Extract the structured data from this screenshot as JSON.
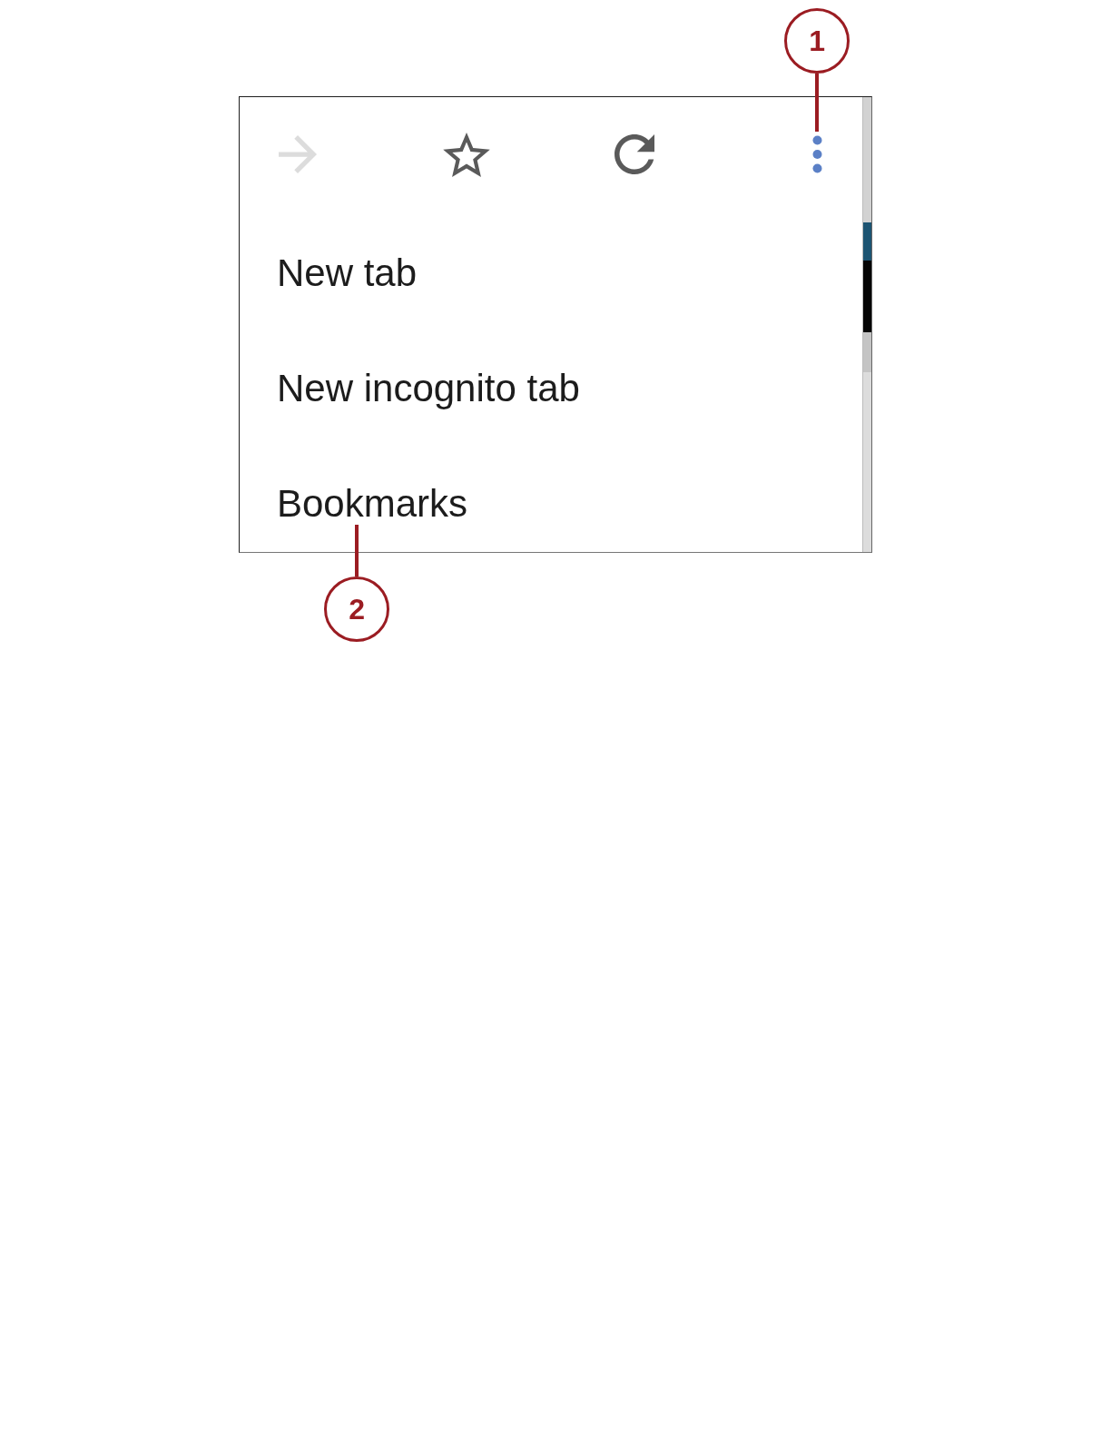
{
  "toolbar": {
    "buttons": [
      {
        "kind": "forward",
        "disabled": true
      },
      {
        "kind": "star",
        "disabled": false
      },
      {
        "kind": "reload",
        "disabled": false
      },
      {
        "kind": "more",
        "disabled": false,
        "callout": "1"
      }
    ]
  },
  "menu": {
    "items": [
      {
        "label": "New tab"
      },
      {
        "label": "New incognito tab"
      },
      {
        "label": "Bookmarks",
        "callout": "2"
      }
    ]
  }
}
